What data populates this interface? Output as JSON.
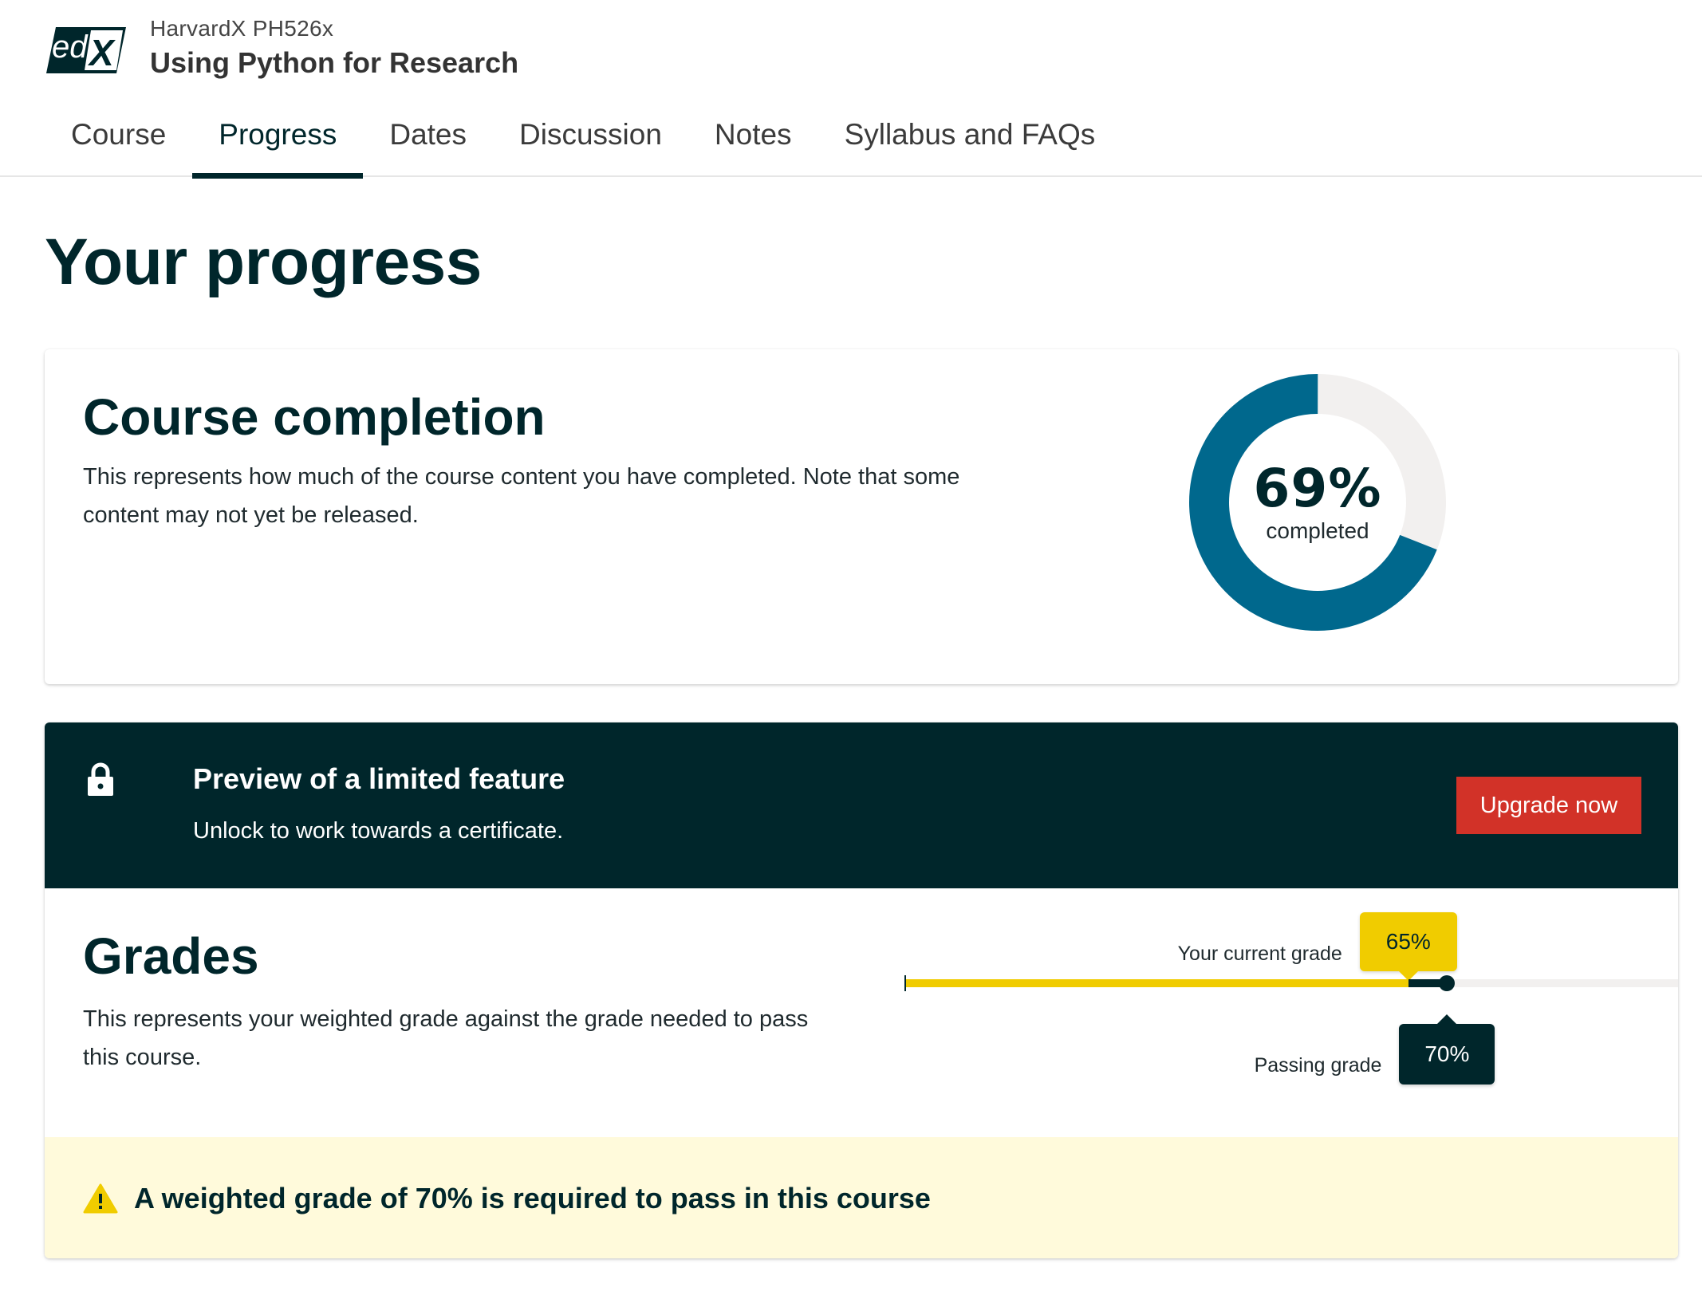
{
  "header": {
    "logo_icon": "edx-logo-icon",
    "course_org": "HarvardX PH526x",
    "course_title": "Using Python for Research"
  },
  "tabs": [
    {
      "label": "Course",
      "active": false
    },
    {
      "label": "Progress",
      "active": true
    },
    {
      "label": "Dates",
      "active": false
    },
    {
      "label": "Discussion",
      "active": false
    },
    {
      "label": "Notes",
      "active": false
    },
    {
      "label": "Syllabus and FAQs",
      "active": false
    }
  ],
  "page_title": "Your progress",
  "completion": {
    "heading": "Course completion",
    "description": "This represents how much of the course content you have completed. Note that some content may not yet be released.",
    "percent_value": 69,
    "percent_label": "69%",
    "caption": "completed",
    "colors": {
      "complete": "#00688d",
      "remaining": "#f2f0ef"
    }
  },
  "banner": {
    "icon": "lock-icon",
    "title": "Preview of a limited feature",
    "subtitle": "Unlock to work towards a certificate.",
    "button_label": "Upgrade now",
    "colors": {
      "background": "#00262b",
      "button": "#d23228"
    }
  },
  "grades": {
    "heading": "Grades",
    "description": "This represents your weighted grade against the grade needed to pass this course.",
    "current_label": "Your current grade",
    "current_value": 65,
    "current_text": "65%",
    "passing_label": "Passing grade",
    "passing_value": 70,
    "passing_text": "70%",
    "colors": {
      "current": "#f0cc00",
      "passing": "#00262b",
      "track": "#f2f0ef"
    }
  },
  "warning": {
    "icon": "warning-icon",
    "text": "A weighted grade of 70% is required to pass in this course",
    "colors": {
      "background": "#fffadb",
      "icon": "#f0cc00"
    }
  }
}
